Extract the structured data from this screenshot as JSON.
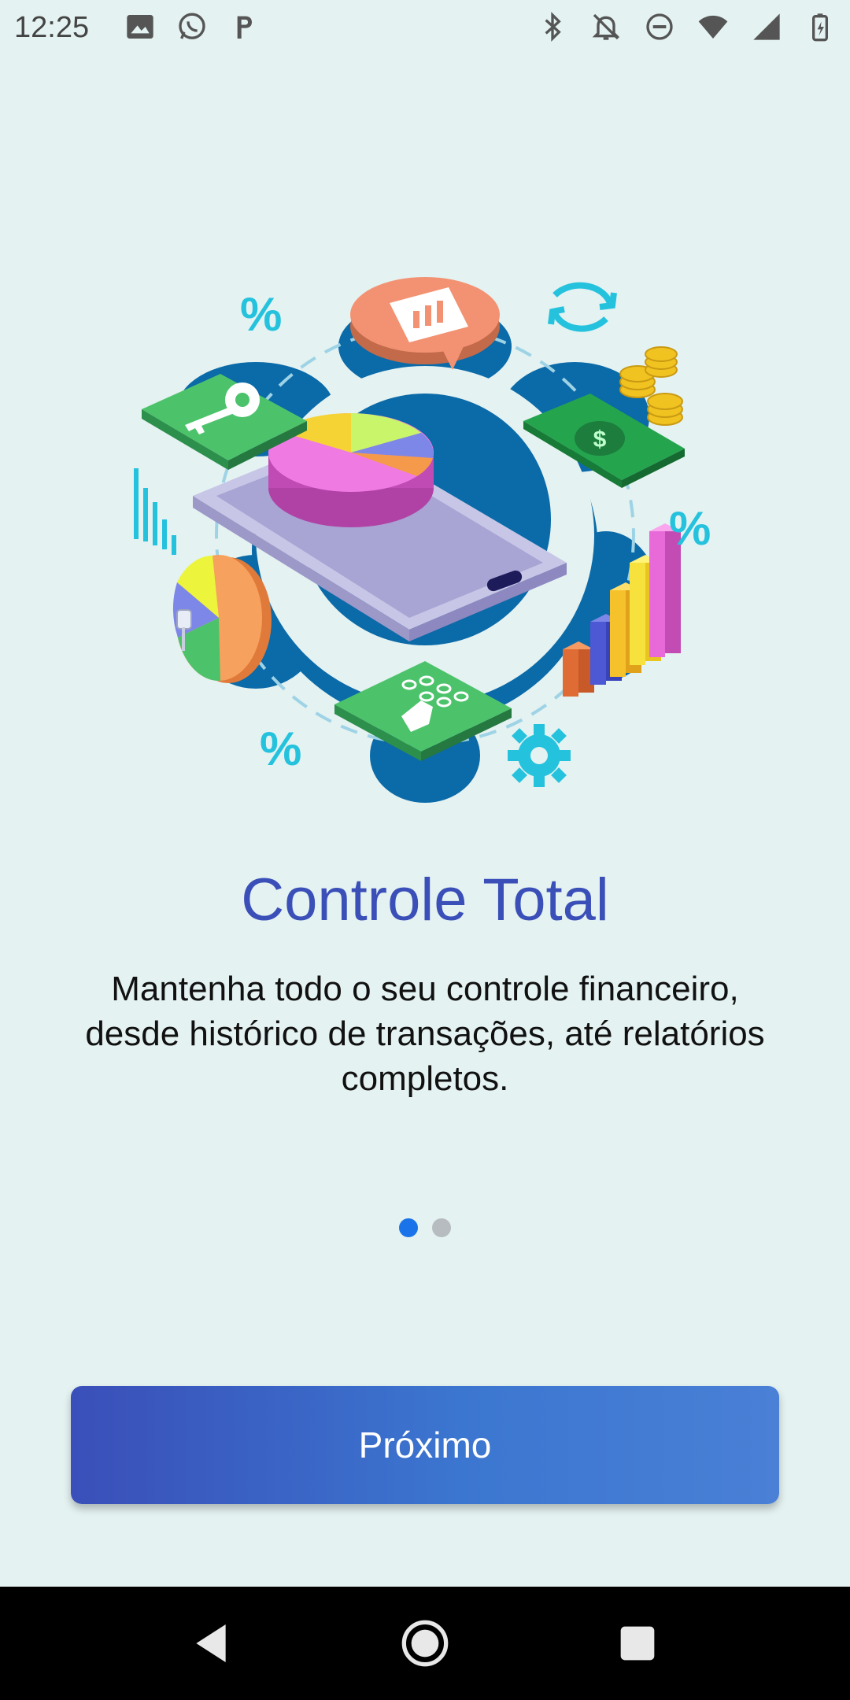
{
  "status_bar": {
    "time": "12:25",
    "left_icons": [
      "image-icon",
      "whatsapp-icon",
      "parking-icon"
    ],
    "right_icons": [
      "bluetooth-icon",
      "notifications-off-icon",
      "do-not-disturb-icon",
      "wifi-icon",
      "signal-icon",
      "battery-icon"
    ]
  },
  "onboarding": {
    "title": "Controle Total",
    "description": "Mantenha todo o seu controle financeiro, desde histórico de transações, até relatórios completos.",
    "page_indicator": {
      "current": 1,
      "total": 2
    },
    "next_button_label": "Próximo"
  },
  "nav_bar": {
    "buttons": [
      "back-icon",
      "home-icon",
      "recents-icon"
    ]
  },
  "colors": {
    "background": "#e4f2f1",
    "title": "#3a4fb8",
    "dot_active": "#1a73e8",
    "dot_inactive": "#b6bcbf",
    "button_start": "#3a4fb9",
    "button_end": "#4a80d6"
  }
}
